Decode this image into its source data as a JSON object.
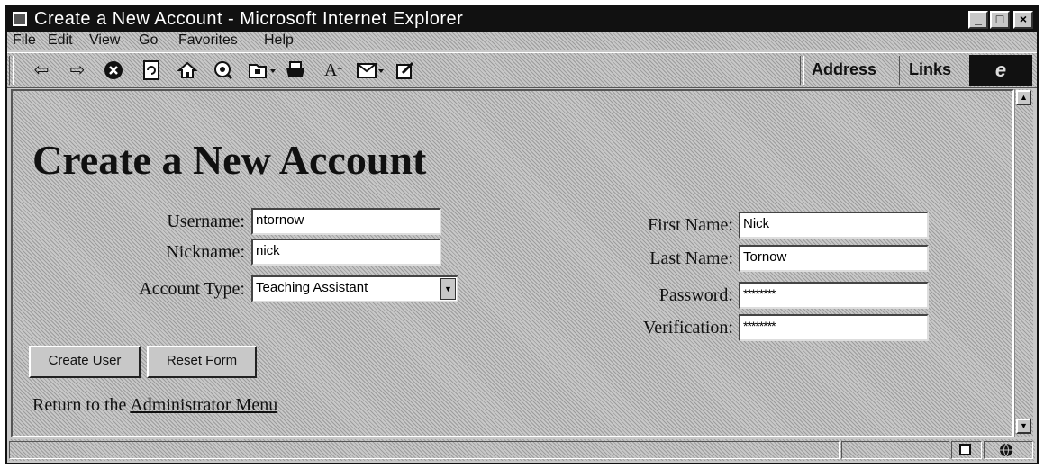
{
  "window": {
    "title": "Create a New Account - Microsoft Internet Explorer"
  },
  "window_controls": {
    "minimize": "_",
    "maximize": "□",
    "close": "×"
  },
  "menu": [
    "File",
    "Edit",
    "View",
    "Go",
    "Favorites",
    "Help"
  ],
  "toolbar": {
    "icons": [
      "back-icon",
      "forward-icon",
      "stop-icon",
      "refresh-icon",
      "home-icon",
      "search-icon",
      "favorites-icon",
      "print-icon",
      "font-icon",
      "mail-icon",
      "edit-icon"
    ],
    "address_label": "Address",
    "links_label": "Links"
  },
  "page": {
    "heading": "Create a New Account",
    "fields": {
      "username": {
        "label": "Username:",
        "value": "ntornow"
      },
      "nickname": {
        "label": "Nickname:",
        "value": "nick"
      },
      "account_type": {
        "label": "Account Type:",
        "value": "Teaching Assistant"
      },
      "first_name": {
        "label": "First Name:",
        "value": "Nick"
      },
      "last_name": {
        "label": "Last Name:",
        "value": "Tornow"
      },
      "password": {
        "label": "Password:",
        "value": "********"
      },
      "verification": {
        "label": "Verification:",
        "value": "********"
      }
    },
    "buttons": {
      "create": "Create User",
      "reset": "Reset Form"
    },
    "return": {
      "prefix": "Return to the ",
      "link": "Administrator Menu"
    }
  }
}
